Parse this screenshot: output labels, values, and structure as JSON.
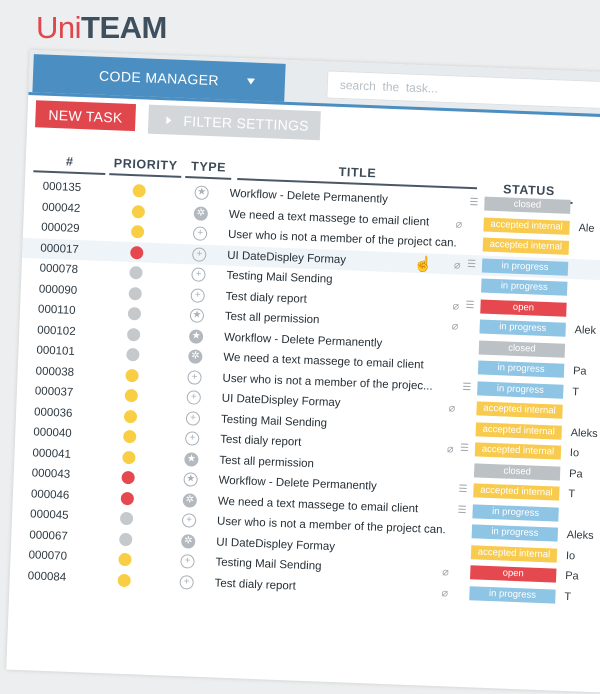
{
  "logo": {
    "uni": "Uni",
    "team": "TEAM"
  },
  "topbar": {
    "code_manager_label": "CODE MANAGER",
    "search_placeholder": "search  the  task..."
  },
  "toolbar": {
    "new_task_label": "NEW TASK",
    "filter_label": "FILTER SETTINGS"
  },
  "columns": {
    "id": "#",
    "priority": "PRIORITY",
    "type": "TYPE",
    "title": "TITLE",
    "status": "STATUS"
  },
  "colors": {
    "accent": "#4b8fc2",
    "new_task": "#e0474c",
    "priority_high": "#e5484e",
    "priority_medium": "#f8cf44",
    "priority_low": "#c5c9cc",
    "status_closed": "#bcc1c5",
    "status_accepted_internal": "#f8cb4e",
    "status_in_progress": "#8ec4e4",
    "status_open": "#e5484e"
  },
  "tasks": [
    {
      "id": "000135",
      "priority": "medium",
      "type": "star-icon",
      "type_filled": false,
      "title": "Workflow - Delete Permanently",
      "attach": false,
      "list": true,
      "status": "closed",
      "status_label": "closed",
      "assignee": ""
    },
    {
      "id": "000042",
      "priority": "medium",
      "type": "gear-icon",
      "type_filled": true,
      "title": "We need a text massege to email client",
      "attach": true,
      "list": false,
      "status": "accepted_internal",
      "status_label": "accepted internal",
      "assignee": "Ale"
    },
    {
      "id": "000029",
      "priority": "medium",
      "type": "plus-icon",
      "type_filled": false,
      "title": "User who is not a member of the project can.",
      "attach": false,
      "list": false,
      "status": "accepted_internal",
      "status_label": "accepted internal",
      "assignee": ""
    },
    {
      "id": "000017",
      "priority": "high",
      "type": "plus-icon",
      "type_filled": false,
      "title": "UI DateDispley Formay",
      "attach": true,
      "list": true,
      "status": "in_progress",
      "status_label": "in progress",
      "assignee": ""
    },
    {
      "id": "000078",
      "priority": "low",
      "type": "plus-icon",
      "type_filled": false,
      "title": "Testing Mail Sending",
      "attach": false,
      "list": false,
      "status": "in_progress",
      "status_label": "in progress",
      "assignee": ""
    },
    {
      "id": "000090",
      "priority": "low",
      "type": "plus-icon",
      "type_filled": false,
      "title": "Test dialy report",
      "attach": true,
      "list": true,
      "status": "open",
      "status_label": "open",
      "assignee": ""
    },
    {
      "id": "000110",
      "priority": "low",
      "type": "star-icon",
      "type_filled": false,
      "title": "Test all permission",
      "attach": true,
      "list": false,
      "status": "in_progress",
      "status_label": "in progress",
      "assignee": "Alek"
    },
    {
      "id": "000102",
      "priority": "low",
      "type": "star-icon",
      "type_filled": true,
      "title": "Workflow - Delete Permanently",
      "attach": false,
      "list": false,
      "status": "closed",
      "status_label": "closed",
      "assignee": ""
    },
    {
      "id": "000101",
      "priority": "low",
      "type": "gear-icon",
      "type_filled": true,
      "title": "We need a text massege to email client",
      "attach": false,
      "list": false,
      "status": "in_progress",
      "status_label": "in progress",
      "assignee": "Pa"
    },
    {
      "id": "000038",
      "priority": "medium",
      "type": "plus-icon",
      "type_filled": false,
      "title": "User who is not a member of the projec...",
      "attach": false,
      "list": true,
      "status": "in_progress",
      "status_label": "in progress",
      "assignee": "T"
    },
    {
      "id": "000037",
      "priority": "medium",
      "type": "plus-icon",
      "type_filled": false,
      "title": "UI DateDispley Formay",
      "attach": true,
      "list": false,
      "status": "accepted_internal",
      "status_label": "accepted internal",
      "assignee": ""
    },
    {
      "id": "000036",
      "priority": "medium",
      "type": "plus-icon",
      "type_filled": false,
      "title": "Testing Mail Sending",
      "attach": false,
      "list": false,
      "status": "accepted_internal",
      "status_label": "accepted internal",
      "assignee": "Aleks"
    },
    {
      "id": "000040",
      "priority": "medium",
      "type": "plus-icon",
      "type_filled": false,
      "title": "Test dialy report",
      "attach": true,
      "list": true,
      "status": "accepted_internal",
      "status_label": "accepted internal",
      "assignee": "Io"
    },
    {
      "id": "000041",
      "priority": "medium",
      "type": "star-icon",
      "type_filled": true,
      "title": "Test all permission",
      "attach": false,
      "list": false,
      "status": "closed",
      "status_label": "closed",
      "assignee": "Pa"
    },
    {
      "id": "000043",
      "priority": "high",
      "type": "star-icon",
      "type_filled": false,
      "title": "Workflow - Delete Permanently",
      "attach": false,
      "list": true,
      "status": "accepted_internal",
      "status_label": "accepted internal",
      "assignee": "T"
    },
    {
      "id": "000046",
      "priority": "high",
      "type": "gear-icon",
      "type_filled": true,
      "title": "We need a text massege to email client",
      "attach": false,
      "list": true,
      "status": "in_progress",
      "status_label": "in progress",
      "assignee": ""
    },
    {
      "id": "000045",
      "priority": "low",
      "type": "plus-icon",
      "type_filled": false,
      "title": "User who is not a member of the project can.",
      "attach": false,
      "list": false,
      "status": "in_progress",
      "status_label": "in progress",
      "assignee": "Aleks"
    },
    {
      "id": "000067",
      "priority": "low",
      "type": "gear-icon",
      "type_filled": true,
      "title": "UI DateDispley Formay",
      "attach": false,
      "list": false,
      "status": "accepted_internal",
      "status_label": "accepted internal",
      "assignee": "Io"
    },
    {
      "id": "000070",
      "priority": "medium",
      "type": "plus-icon",
      "type_filled": false,
      "title": "Testing Mail Sending",
      "attach": true,
      "list": false,
      "status": "open",
      "status_label": "open",
      "assignee": "Pa"
    },
    {
      "id": "000084",
      "priority": "medium",
      "type": "plus-icon",
      "type_filled": false,
      "title": "Test dialy report",
      "attach": true,
      "list": false,
      "status": "in_progress",
      "status_label": "in progress",
      "assignee": "T"
    }
  ]
}
